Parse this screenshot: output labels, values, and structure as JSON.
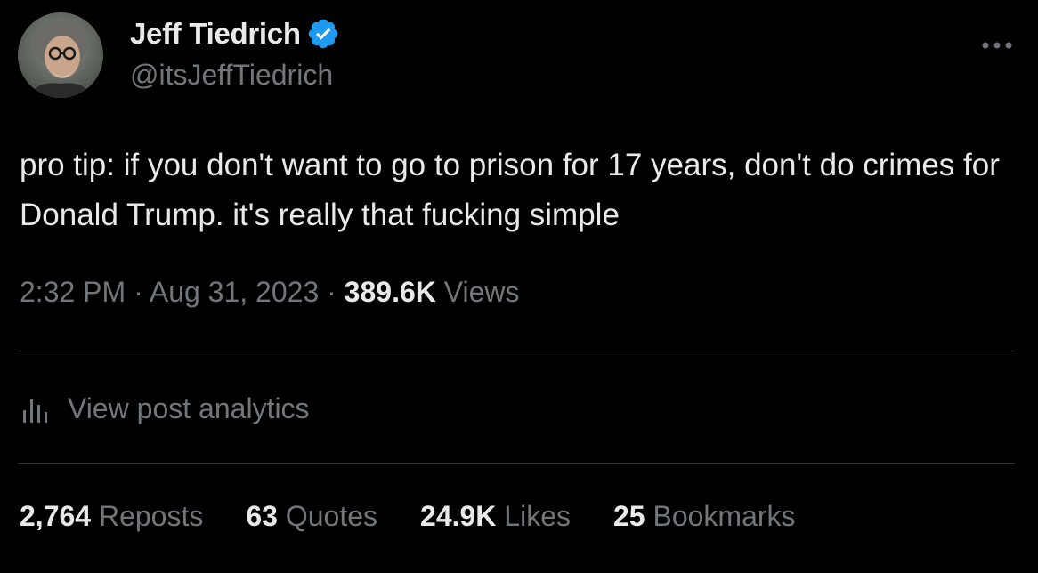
{
  "author": {
    "display_name": "Jeff Tiedrich",
    "handle": "@itsJeffTiedrich",
    "verified_color": "#1d9bf0",
    "avatar_icon": "avatar-photo"
  },
  "more_icon": "more-horizontal-icon",
  "tweet": {
    "text": "pro tip: if you don't want to go to prison for 17 years, don't do crimes for Donald Trump. it's really that fucking simple"
  },
  "meta": {
    "time": "2:32 PM",
    "separator1": " · ",
    "date": "Aug 31, 2023",
    "separator2": " · ",
    "views_count": "389.6K",
    "views_label": "Views"
  },
  "analytics": {
    "icon": "bar-chart-icon",
    "label": "View post analytics"
  },
  "stats": [
    {
      "count": "2,764",
      "label": "Reposts"
    },
    {
      "count": "63",
      "label": "Quotes"
    },
    {
      "count": "24.9K",
      "label": "Likes"
    },
    {
      "count": "25",
      "label": "Bookmarks"
    }
  ],
  "colors": {
    "background": "#000000",
    "primary_text": "#e7e9ea",
    "secondary_text": "#71767b",
    "divider": "#2f3336"
  }
}
